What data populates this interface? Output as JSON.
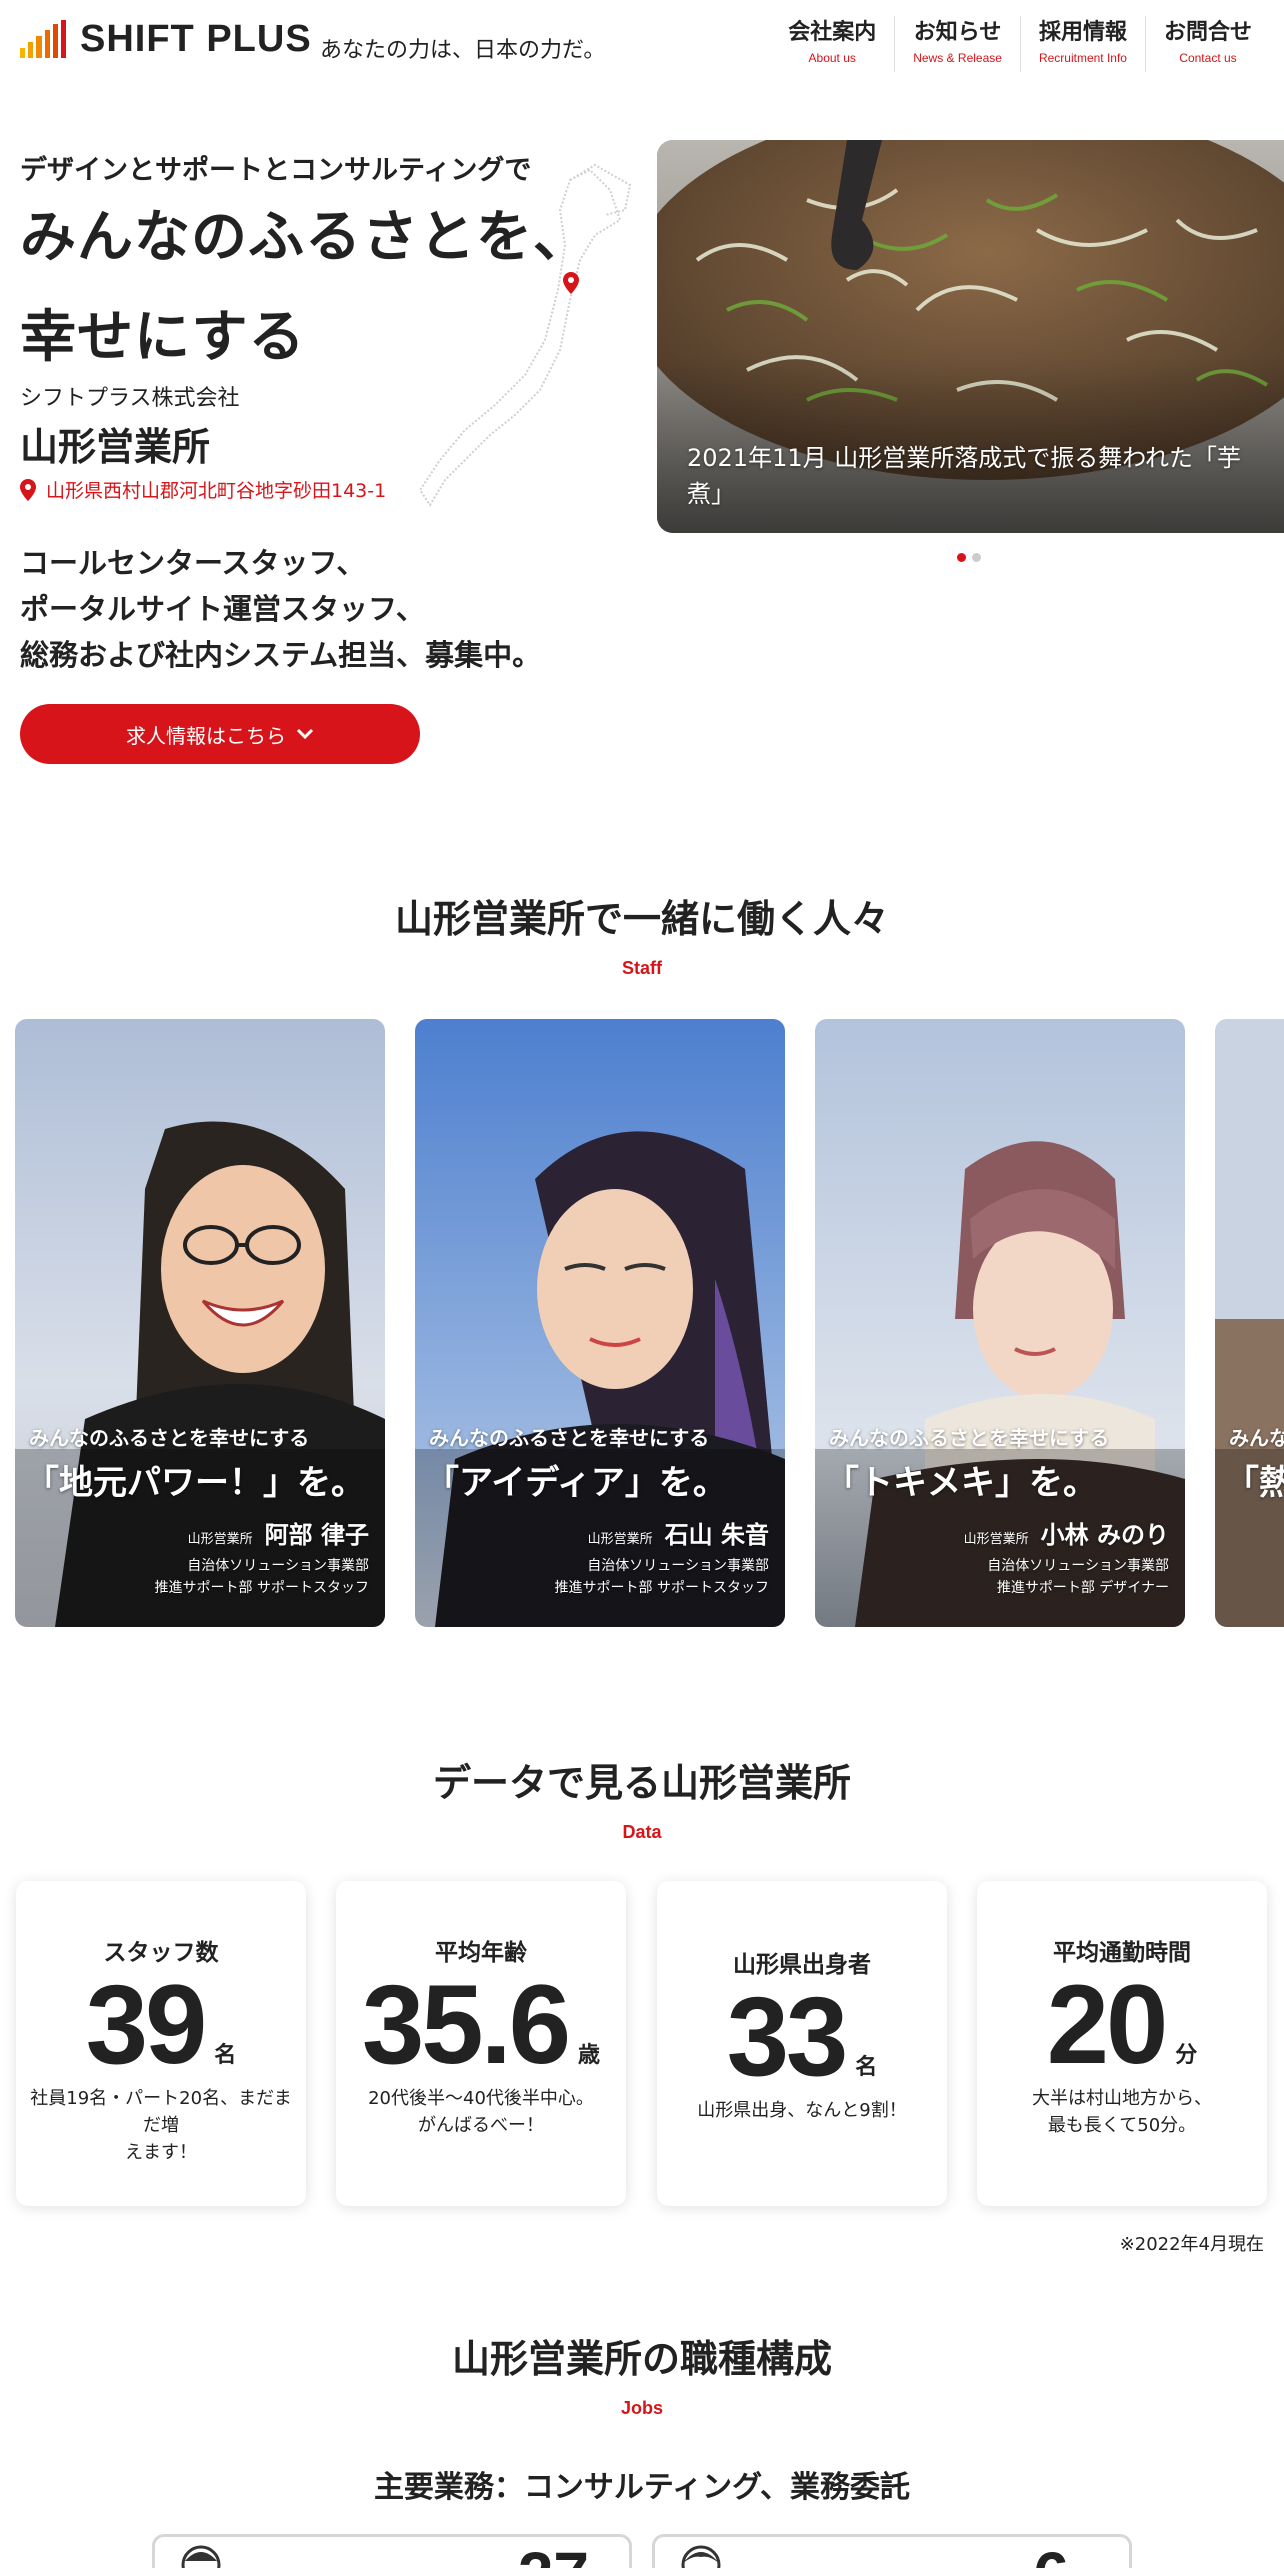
{
  "header": {
    "logo_text": "SHIFT PLUS",
    "tagline": "あなたの力は、日本の力だ。",
    "nav": [
      {
        "jp": "会社案内",
        "en": "About us"
      },
      {
        "jp": "お知らせ",
        "en": "News & Release"
      },
      {
        "jp": "採用情報",
        "en": "Recruitment Info"
      },
      {
        "jp": "お問合せ",
        "en": "Contact us"
      }
    ]
  },
  "hero": {
    "subtitle": "デザインとサポートとコンサルティングで",
    "title_line1": "みんなのふるさとを、",
    "title_line2": "幸せにする",
    "company": "シフトプラス株式会社",
    "office": "山形営業所",
    "address": "山形県西村山郡河北町谷地字砂田143-1",
    "recruit_line1": "コールセンタースタッフ、",
    "recruit_line2": "ポータルサイト運営スタッフ、",
    "recruit_line3": "総務および社内システム担当、募集中。",
    "cta_label": "求人情報はこちら"
  },
  "slider": {
    "caption": "2021年11月 山形営業所落成式で振る舞われた「芋煮」"
  },
  "staff_section": {
    "title": "山形営業所で一緒に働く人々",
    "subtitle": "Staff",
    "cards": [
      {
        "lead": "みんなのふるさとを幸せにする",
        "quote": "「地元パワー！」を。",
        "office": "山形営業所",
        "name": "阿部 律子",
        "dept1": "自治体ソリューション事業部",
        "dept2": "推進サポート部 サポートスタッフ"
      },
      {
        "lead": "みんなのふるさとを幸せにする",
        "quote": "「アイディア」を。",
        "office": "山形営業所",
        "name": "石山 朱音",
        "dept1": "自治体ソリューション事業部",
        "dept2": "推進サポート部 サポートスタッフ"
      },
      {
        "lead": "みんなのふるさとを幸せにする",
        "quote": "「トキメキ」を。",
        "office": "山形営業所",
        "name": "小林 みのり",
        "dept1": "自治体ソリューション事業部",
        "dept2": "推進サポート部 デザイナー"
      },
      {
        "lead": "みんな",
        "quote": "「熱"
      }
    ]
  },
  "data_section": {
    "title": "データで見る山形営業所",
    "subtitle": "Data",
    "items": [
      {
        "label": "スタッフ数",
        "value": "39",
        "unit": "名",
        "desc1": "社員19名・パート20名、まだまだ増",
        "desc2": "えます！"
      },
      {
        "label": "平均年齢",
        "value": "35.6",
        "unit": "歳",
        "desc1": "20代後半〜40代後半中心。",
        "desc2": "がんばるべー！"
      },
      {
        "label": "山形県出身者",
        "value": "33",
        "unit": "名",
        "desc1": "山形県出身、なんと9割！",
        "desc2": ""
      },
      {
        "label": "平均通勤時間",
        "value": "20",
        "unit": "分",
        "desc1": "大半は村山地方から、",
        "desc2": "最も長くて50分。"
      }
    ],
    "as_of": "※2022年4月現在"
  },
  "jobs_section": {
    "title": "山形営業所の職種構成",
    "subtitle": "Jobs",
    "main_work": "主要業務：コンサルティング、業務委託",
    "counts": [
      "27",
      "6"
    ]
  }
}
